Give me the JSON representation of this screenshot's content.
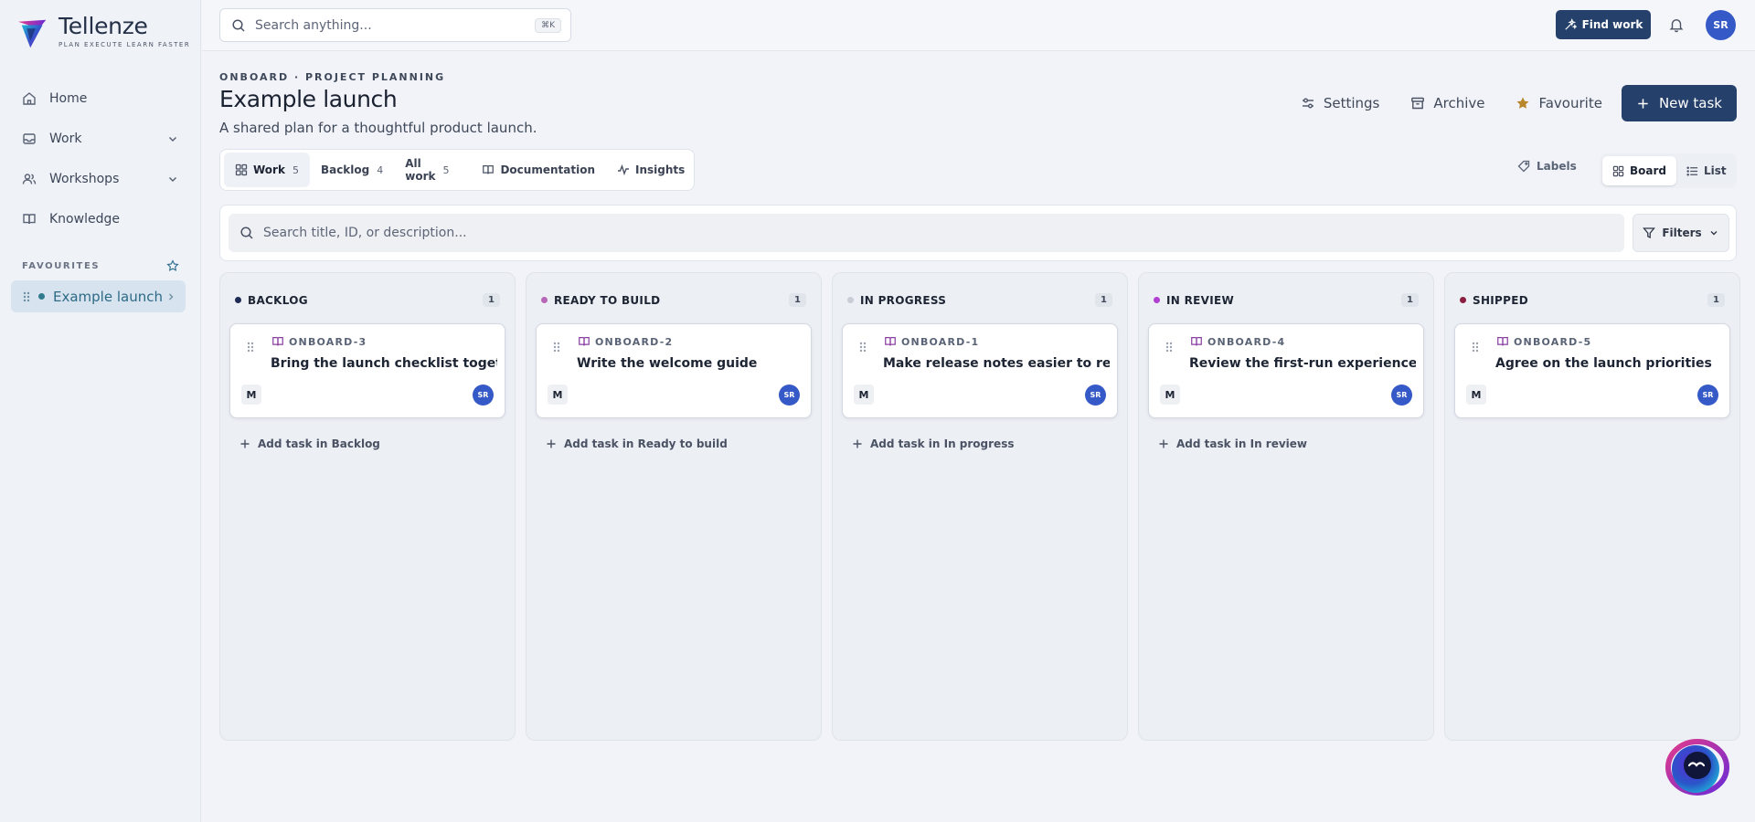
{
  "app": {
    "name": "Tellenze",
    "tagline": "PLAN EXECUTE LEARN FASTER"
  },
  "sidebar": {
    "nav": [
      {
        "label": "Home",
        "icon": "home-icon"
      },
      {
        "label": "Work",
        "icon": "inbox-icon",
        "expandable": true
      },
      {
        "label": "Workshops",
        "icon": "users-icon",
        "expandable": true
      },
      {
        "label": "Knowledge",
        "icon": "book-icon"
      }
    ],
    "favourites_heading": "FAVOURITES",
    "favourites": [
      {
        "label": "Example launch"
      }
    ]
  },
  "topbar": {
    "search_placeholder": "Search anything...",
    "search_shortcut": "⌘K",
    "find_work_label": "Find work",
    "user_initials": "SR"
  },
  "header": {
    "breadcrumb": "ONBOARD · PROJECT PLANNING",
    "title": "Example launch",
    "subtitle": "A shared plan for a thoughtful product launch.",
    "actions": {
      "settings": "Settings",
      "archive": "Archive",
      "favourite": "Favourite",
      "new_task": "New task"
    }
  },
  "tabs": [
    {
      "label": "Work",
      "count": "5",
      "active": true
    },
    {
      "label": "Backlog",
      "count": "4"
    },
    {
      "label": "All work",
      "count": "5"
    },
    {
      "label": "Documentation"
    },
    {
      "label": "Insights"
    }
  ],
  "view": {
    "labels": "Labels",
    "board": "Board",
    "list": "List",
    "active": "Board"
  },
  "filter": {
    "search_placeholder": "Search title, ID, or description...",
    "filters_label": "Filters"
  },
  "columns": [
    {
      "title": "BACKLOG",
      "count": "1",
      "color": "#1f2a55",
      "card": {
        "id": "ONBOARD-3",
        "title": "Bring the launch checklist together",
        "size": "M",
        "assignee": "SR"
      },
      "add_label": "Add task in Backlog"
    },
    {
      "title": "READY TO BUILD",
      "count": "1",
      "color": "#b767b8",
      "card": {
        "id": "ONBOARD-2",
        "title": "Write the welcome guide",
        "size": "M",
        "assignee": "SR"
      },
      "add_label": "Add task in Ready to build"
    },
    {
      "title": "IN PROGRESS",
      "count": "1",
      "color": "#c9ccd4",
      "card": {
        "id": "ONBOARD-1",
        "title": "Make release notes easier to review",
        "size": "M",
        "assignee": "SR"
      },
      "add_label": "Add task in In progress"
    },
    {
      "title": "IN REVIEW",
      "count": "1",
      "color": "#b13fd1",
      "card": {
        "id": "ONBOARD-4",
        "title": "Review the first-run experience",
        "size": "M",
        "assignee": "SR"
      },
      "add_label": "Add task in In review"
    },
    {
      "title": "SHIPPED",
      "count": "1",
      "color": "#8a1f3f",
      "card": {
        "id": "ONBOARD-5",
        "title": "Agree on the launch priorities",
        "size": "M",
        "assignee": "SR"
      },
      "add_label": "Add task in Shipped"
    }
  ],
  "colors": {
    "brand_navy": "#25406b",
    "avatar_blue": "#3559c7",
    "favourite_gold": "#b8862b",
    "card_icon_purple": "#8b3fa3"
  }
}
